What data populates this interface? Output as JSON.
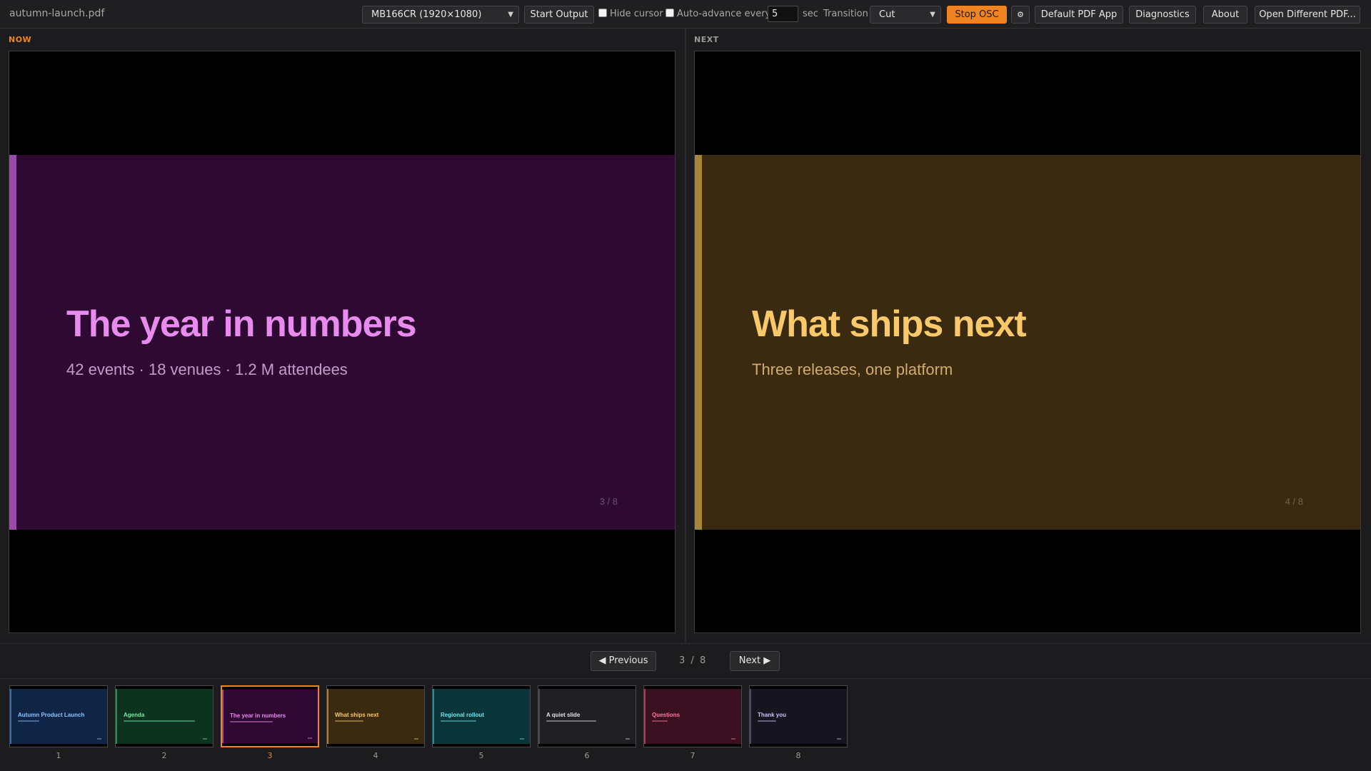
{
  "app": {
    "filename": "autumn-launch.pdf"
  },
  "toolbar": {
    "display_select": "MB166CR (1920×1080)",
    "start_output_label": "Start Output",
    "hide_cursor_label": "Hide cursor",
    "auto_advance_label": "Auto-advance every",
    "auto_advance_value": "5",
    "sec_label": "sec",
    "transition_label": "Transition",
    "transition_value": "Cut",
    "stop_osc_label": "Stop OSC",
    "osc_settings_icon": "gear-icon",
    "default_pdf_app_label": "Default PDF App",
    "diagnostics_label": "Diagnostics",
    "about_label": "About",
    "open_pdf_label": "Open Different PDF..."
  },
  "now": {
    "label": "NOW",
    "title": "The year in numbers",
    "subtitle": "42 events · 18 venues · 1.2 M attendees",
    "page": "3 / 8"
  },
  "next": {
    "label": "NEXT",
    "title": "What ships next",
    "subtitle": "Three releases, one platform",
    "page": "4 / 8"
  },
  "nav": {
    "previous_label": "◀ Previous",
    "next_label": "Next ▶",
    "current": "3",
    "separator": "/",
    "total": "8"
  },
  "thumbs": [
    {
      "num": "1",
      "title": "Autumn Product Launch"
    },
    {
      "num": "2",
      "title": "Agenda"
    },
    {
      "num": "3",
      "title": "The year in numbers"
    },
    {
      "num": "4",
      "title": "What ships next"
    },
    {
      "num": "5",
      "title": "Regional rollout"
    },
    {
      "num": "6",
      "title": "A quiet slide"
    },
    {
      "num": "7",
      "title": "Questions"
    },
    {
      "num": "8",
      "title": "Thank you"
    }
  ],
  "colors": {
    "accent": "#f08423",
    "now_bg": "#2e0a33",
    "now_bar": "#9a4aa8",
    "now_title": "#e88aee",
    "next_bg": "#3a2a0f",
    "next_bar": "#a8843a",
    "next_title": "#fbc86a"
  }
}
